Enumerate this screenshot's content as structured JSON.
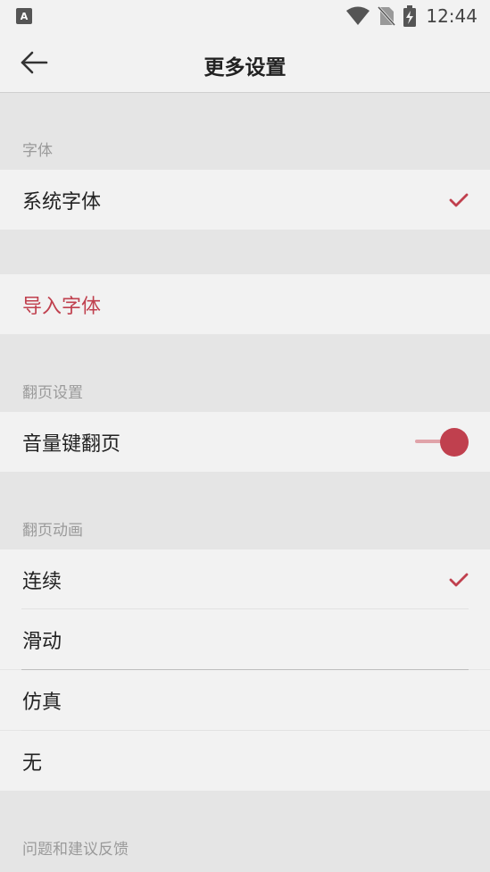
{
  "status_bar": {
    "app_badge": "A",
    "time": "12:44"
  },
  "header": {
    "title": "更多设置"
  },
  "sections": {
    "font": {
      "label": "字体",
      "system_font": "系统字体",
      "import_font": "导入字体"
    },
    "page_turn": {
      "label": "翻页设置",
      "volume_key": "音量键翻页",
      "volume_key_enabled": true
    },
    "animation": {
      "label": "翻页动画",
      "options": [
        "连续",
        "滑动",
        "仿真",
        "无"
      ],
      "selected": "连续"
    },
    "feedback": {
      "label": "问题和建议反馈"
    }
  },
  "colors": {
    "accent": "#c0404e",
    "background": "#e5e5e5",
    "row_background": "#f2f2f2"
  }
}
